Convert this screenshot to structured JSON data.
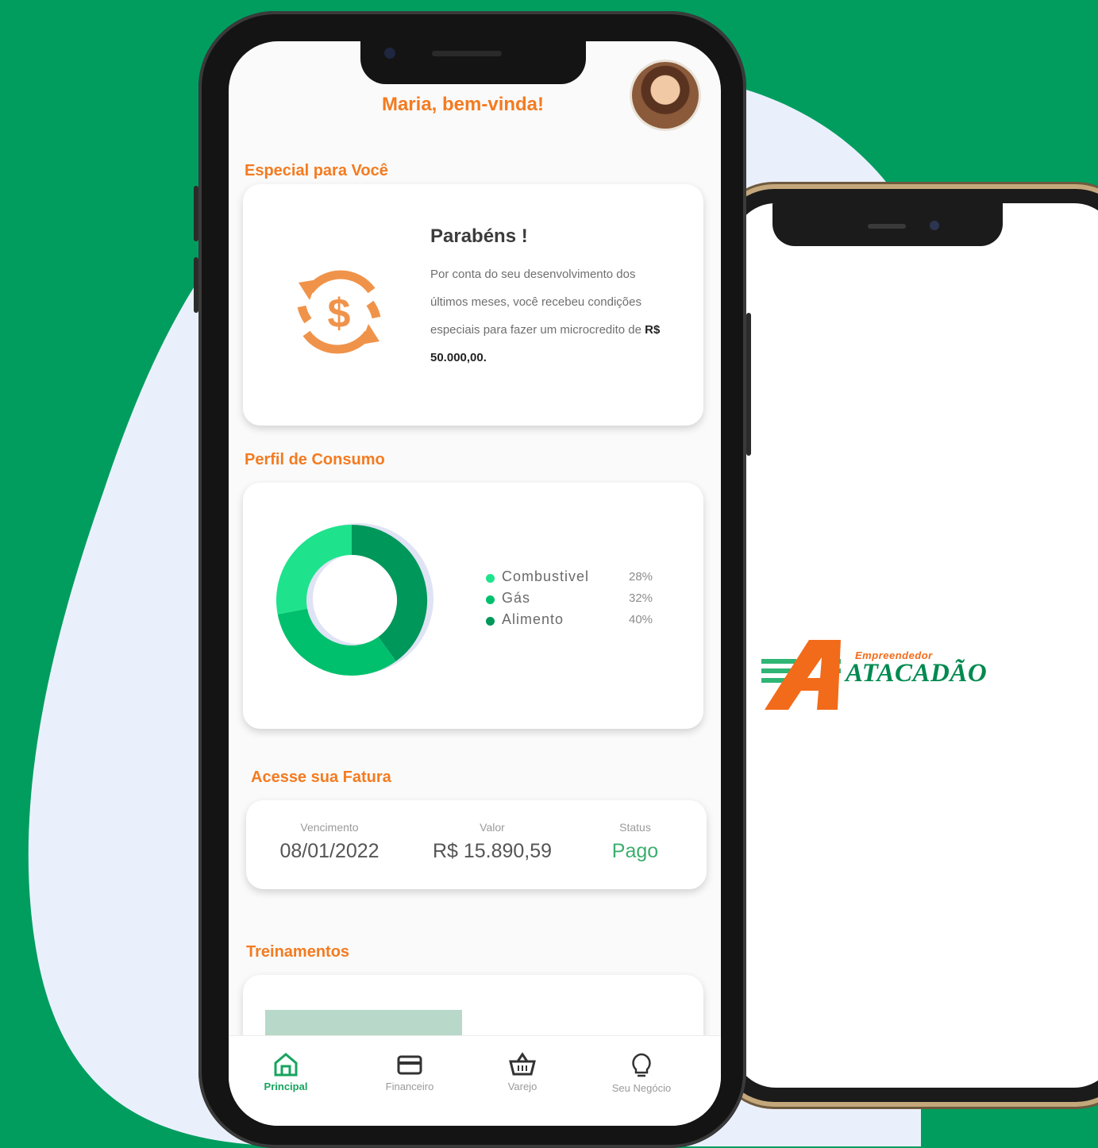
{
  "app": {
    "greeting": "Maria, bem-vinda!",
    "avatar_icon": "user-avatar"
  },
  "special": {
    "section_title": "Especial para Você",
    "card_title": "Parabéns !",
    "card_text": "Por conta do seu desenvolvimento dos últimos meses, você recebeu condições especiais para fazer um microcredito de",
    "amount": "R$ 50.000,00.",
    "icon": "dollar-exchange-icon"
  },
  "consumption": {
    "section_title": "Perfil de Consumo",
    "legend": [
      {
        "name": "Combustivel",
        "value": "28%",
        "color": "#1ee38c"
      },
      {
        "name": "Gás",
        "value": "32%",
        "color": "#00c06d"
      },
      {
        "name": "Alimento",
        "value": "40%",
        "color": "#00975a"
      }
    ]
  },
  "chart_data": {
    "type": "pie",
    "categories": [
      "Combustivel",
      "Gás",
      "Alimento"
    ],
    "values": [
      28,
      32,
      40
    ],
    "colors": [
      "#1ee38c",
      "#00c06d",
      "#00975a"
    ],
    "legend_position": "right"
  },
  "invoice": {
    "section_title": "Acesse sua Fatura",
    "due_label": "Vencimento",
    "due_value": "08/01/2022",
    "value_label": "Valor",
    "value_value": "R$ 15.890,59",
    "status_label": "Status",
    "status_value": "Pago"
  },
  "training": {
    "section_title": "Treinamentos"
  },
  "tabs": [
    {
      "label": "Principal",
      "icon": "home-icon",
      "active": true
    },
    {
      "label": "Financeiro",
      "icon": "card-icon",
      "active": false
    },
    {
      "label": "Varejo",
      "icon": "basket-icon",
      "active": false
    },
    {
      "label": "Seu Negócio",
      "icon": "lightbulb-icon",
      "active": false
    }
  ],
  "brand": {
    "tagline": "Empreendedor",
    "name": "ATACADÃO",
    "accent_orange": "#f26b1a",
    "accent_green": "#008a4f"
  },
  "colors": {
    "background": "#009d5f",
    "blob": "#eaf0fb",
    "orange": "#f47b20"
  }
}
